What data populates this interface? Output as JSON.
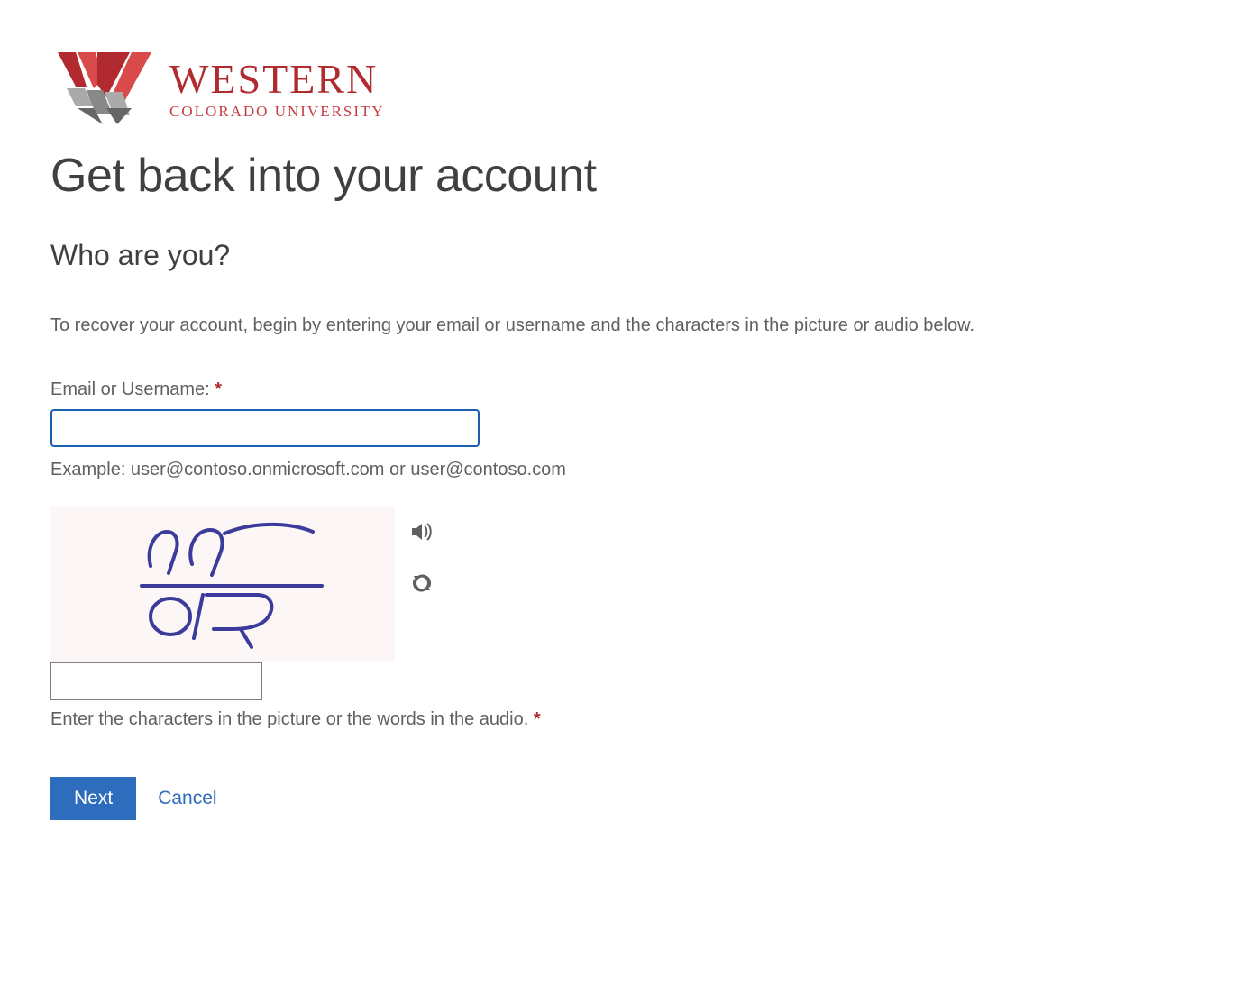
{
  "logo": {
    "main": "WESTERN",
    "sub": "COLORADO UNIVERSITY"
  },
  "page": {
    "title": "Get back into your account",
    "subtitle": "Who are you?",
    "instruction": "To recover your account, begin by entering your email or username and the characters in the picture or audio below."
  },
  "email": {
    "label": "Email or Username: ",
    "required_mark": "*",
    "value": "",
    "example": "Example: user@contoso.onmicrosoft.com or user@contoso.com"
  },
  "captcha": {
    "value": "",
    "instruction": "Enter the characters in the picture or the words in the audio. ",
    "required_mark": "*"
  },
  "buttons": {
    "next": "Next",
    "cancel": "Cancel"
  }
}
